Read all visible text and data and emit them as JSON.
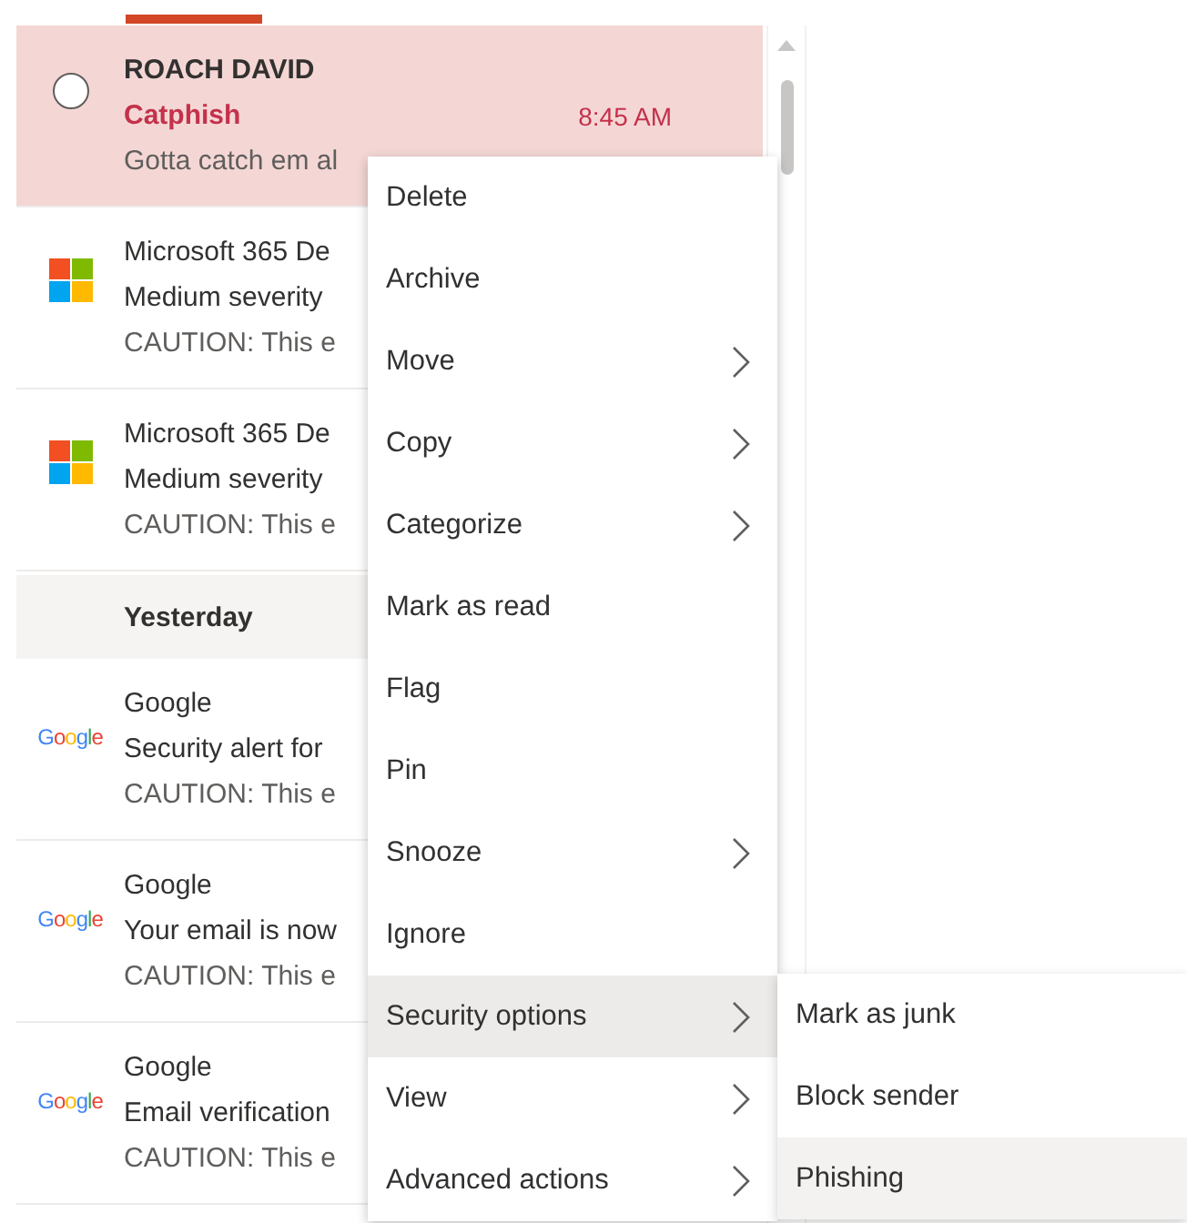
{
  "messages": [
    {
      "kind": "checkbox",
      "checked": false,
      "selected": true,
      "sender": "ROACH DAVID",
      "subject": "Catphish",
      "time": "8:45 AM",
      "preview": "Gotta catch em al"
    },
    {
      "kind": "microsoft",
      "selected": false,
      "sender": "Microsoft 365 De",
      "subject": "Medium severity",
      "preview": "CAUTION: This e"
    },
    {
      "kind": "microsoft",
      "selected": false,
      "sender": "Microsoft 365 De",
      "subject": "Medium severity",
      "preview": "CAUTION: This e"
    }
  ],
  "section_header": "Yesterday",
  "yesterday_messages": [
    {
      "kind": "google",
      "selected": false,
      "sender": "Google",
      "logo": "Google",
      "subject": "Security alert for",
      "preview": "CAUTION: This e"
    },
    {
      "kind": "google",
      "selected": false,
      "sender": "Google",
      "logo": "Google",
      "subject": "Your email is now",
      "preview": "CAUTION: This e"
    },
    {
      "kind": "google",
      "selected": false,
      "sender": "Google",
      "logo": "Google",
      "subject": "Email verification",
      "preview": "CAUTION: This e"
    }
  ],
  "context_menu": [
    {
      "label": "Delete",
      "submenu": false,
      "selected": false
    },
    {
      "label": "Archive",
      "submenu": false,
      "selected": false
    },
    {
      "label": "Move",
      "submenu": true,
      "selected": false
    },
    {
      "label": "Copy",
      "submenu": true,
      "selected": false
    },
    {
      "label": "Categorize",
      "submenu": true,
      "selected": false
    },
    {
      "label": "Mark as read",
      "submenu": false,
      "selected": false
    },
    {
      "label": "Flag",
      "submenu": false,
      "selected": false
    },
    {
      "label": "Pin",
      "submenu": false,
      "selected": false
    },
    {
      "label": "Snooze",
      "submenu": true,
      "selected": false
    },
    {
      "label": "Ignore",
      "submenu": false,
      "selected": false
    },
    {
      "label": "Security options",
      "submenu": true,
      "selected": true
    },
    {
      "label": "View",
      "submenu": true,
      "selected": false
    },
    {
      "label": "Advanced actions",
      "submenu": true,
      "selected": false
    }
  ],
  "submenu": [
    {
      "label": "Mark as junk",
      "selected": false
    },
    {
      "label": "Block sender",
      "selected": false
    },
    {
      "label": "Phishing",
      "selected": true
    }
  ]
}
